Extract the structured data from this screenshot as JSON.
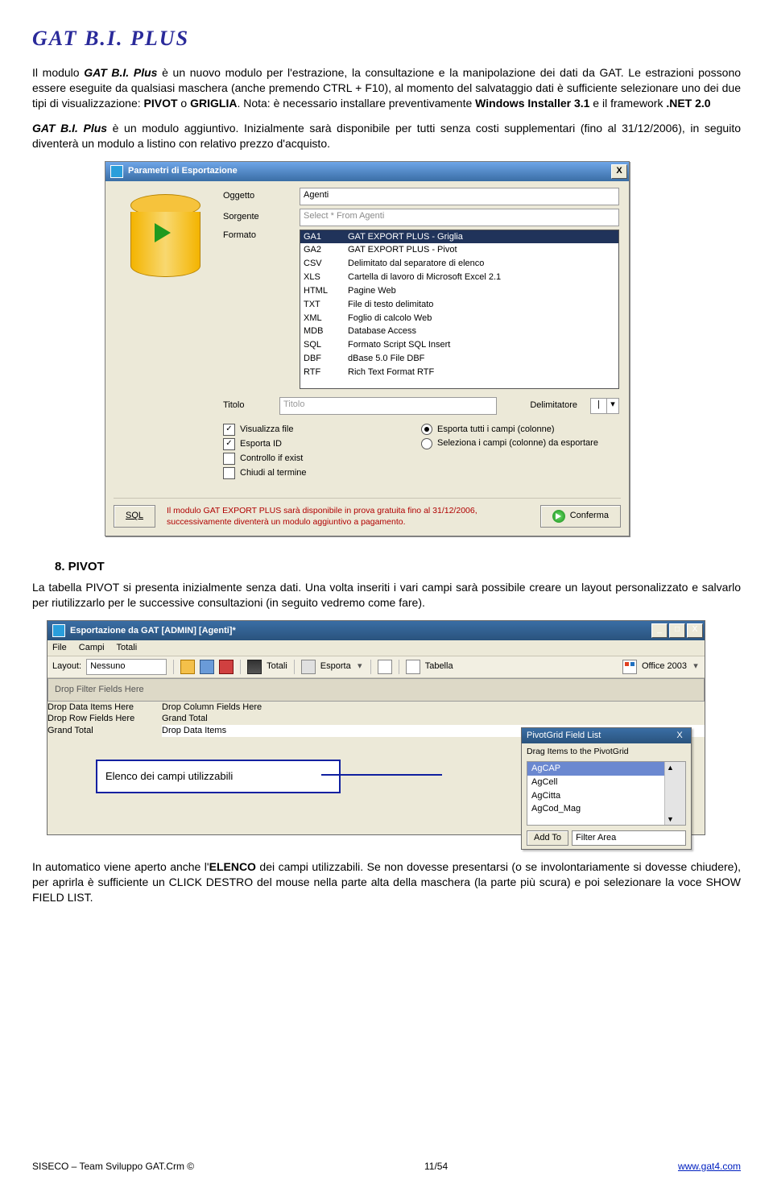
{
  "title": "GAT B.I. PLUS",
  "para1_prefix": "Il modulo ",
  "para1_bi": "GAT B.I. Plus",
  "para1_rest": " è un nuovo modulo per l'estrazione, la consultazione e la manipolazione dei dati da GAT. Le estrazioni possono essere eseguite da qualsiasi maschera (anche premendo CTRL + F10), al momento del salvataggio dati è sufficiente selezionare uno dei due tipi di visualizzazione: ",
  "para1_b1": "PIVOT",
  "para1_mid": " o ",
  "para1_b2": "GRIGLIA",
  "para1_after": ". Nota: è necessario installare preventivamente ",
  "para1_b3": "Windows Installer 3.1",
  "para1_mid2": " e il framework ",
  "para1_b4": ".NET 2.0",
  "para2_bi": "GAT B.I. Plus",
  "para2_rest": " è un modulo aggiuntivo. Inizialmente sarà disponibile per tutti senza costi supplementari (fino al 31/12/2006), in seguito diventerà un modulo a listino con relativo prezzo d'acquisto.",
  "dialog1": {
    "title": "Parametri di Esportazione",
    "labels": {
      "oggetto": "Oggetto",
      "sorgente": "Sorgente",
      "formato": "Formato",
      "titolo": "Titolo",
      "delimitatore": "Delimitatore"
    },
    "oggetto": "Agenti",
    "sorgente": "Select * From Agenti",
    "formato_sel": {
      "code": "GA1",
      "desc": "GAT EXPORT PLUS - Griglia"
    },
    "formati": [
      {
        "code": "GA2",
        "desc": "GAT EXPORT PLUS - Pivot"
      },
      {
        "code": "CSV",
        "desc": "Delimitato dal separatore di elenco"
      },
      {
        "code": "XLS",
        "desc": "Cartella di lavoro di Microsoft Excel 2.1"
      },
      {
        "code": "HTML",
        "desc": "Pagine Web"
      },
      {
        "code": "TXT",
        "desc": "File di testo delimitato"
      },
      {
        "code": "XML",
        "desc": "Foglio di calcolo Web"
      },
      {
        "code": "MDB",
        "desc": "Database Access"
      },
      {
        "code": "SQL",
        "desc": "Formato Script SQL Insert"
      },
      {
        "code": "DBF",
        "desc": "dBase 5.0 File DBF"
      },
      {
        "code": "RTF",
        "desc": "Rich Text Format RTF"
      }
    ],
    "titolo_placeholder": "Titolo",
    "delim_value": "|",
    "checks": {
      "visualizza": "Visualizza file",
      "esporta": "Esporta ID",
      "controllo": "Controllo if exist",
      "chiudi": "Chiudi al termine"
    },
    "radios": {
      "tutti": "Esporta tutti i campi (colonne)",
      "sel": "Seleziona i campi (colonne) da esportare"
    },
    "foot_sql": "SQL",
    "foot_msg": "Il modulo GAT EXPORT PLUS sarà disponibile in prova gratuita fino al 31/12/2006, successivamente diventerà un modulo aggiuntivo a pagamento.",
    "foot_conf": "Conferma"
  },
  "sect8_title": "8. PIVOT",
  "para3": "La tabella PIVOT si presenta inizialmente senza dati. Una volta inseriti i vari campi sarà possibile creare un layout personalizzato e salvarlo per riutilizzarlo per le successive consultazioni (in seguito vedremo come fare).",
  "win2": {
    "title": "Esportazione da GAT [ADMIN] [Agenti]*",
    "menu": [
      "File",
      "Campi",
      "Totali"
    ],
    "layout_lbl": "Layout:",
    "layout_val": "Nessuno",
    "totali": "Totali",
    "esporta": "Esporta",
    "tabella": "Tabella",
    "office": "Office 2003",
    "drop_filter": "Drop Filter Fields Here",
    "drop_data_here": "Drop Data Items Here",
    "drop_col": "Drop Column Fields Here",
    "drop_row": "Drop Row Fields Here",
    "grand": "Grand Total",
    "drop_data": "Drop Data Items",
    "fieldlist": {
      "title": "PivotGrid Field List",
      "hint": "Drag Items to the PivotGrid",
      "items": [
        "AgCAP",
        "AgCell",
        "AgCitta",
        "AgCod_Mag"
      ],
      "addto": "Add To",
      "area": "Filter Area"
    }
  },
  "callout": "Elenco dei campi utilizzabili",
  "para4_p": "In automatico viene aperto anche l'",
  "para4_b": "ELENCO",
  "para4_r": " dei campi utilizzabili. Se non dovesse presentarsi (o se involontariamente si dovesse chiudere), per aprirla è sufficiente un CLICK DESTRO del mouse nella parte alta della maschera (la parte più scura) e poi selezionare la voce SHOW FIELD LIST.",
  "footer": {
    "left": "SISECO – Team Sviluppo GAT.Crm",
    "copy": "©",
    "center": "11/54",
    "right": "www.gat4.com"
  }
}
